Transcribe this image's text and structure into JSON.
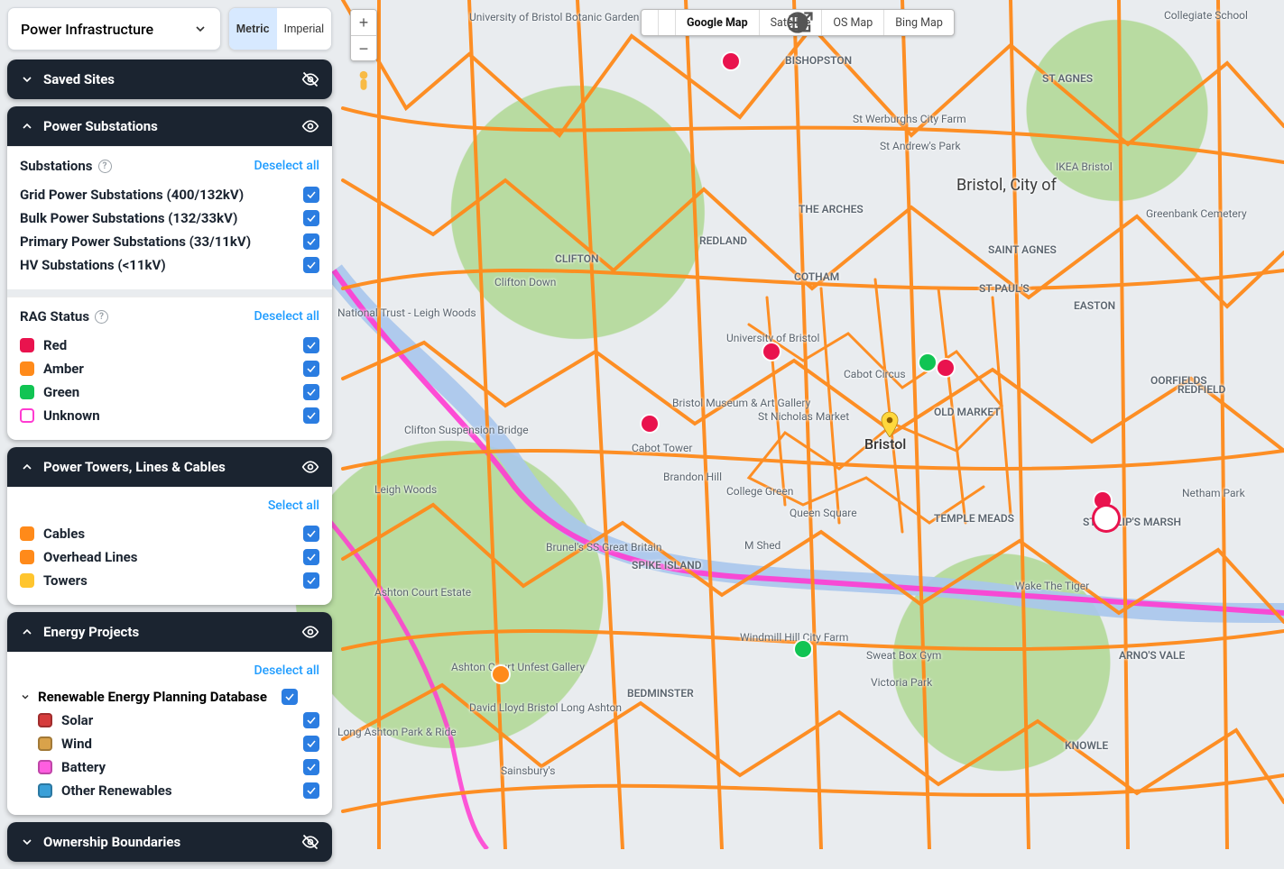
{
  "units": {
    "metric": "Metric",
    "imperial": "Imperial",
    "active": "metric"
  },
  "category": {
    "value": "Power Infrastructure"
  },
  "map_types": {
    "google": "Google Map",
    "satellite": "Satellite",
    "os": "OS Map",
    "bing": "Bing Map",
    "active": "google"
  },
  "sections": {
    "saved_sites": {
      "title": "Saved Sites",
      "expanded": false,
      "visible": false
    },
    "power_substations": {
      "title": "Power Substations",
      "expanded": true,
      "visible": true,
      "group_title": "Substations",
      "action": "Deselect all",
      "items": [
        {
          "label": "Grid Power Substations (400/132kV)",
          "checked": true
        },
        {
          "label": "Bulk Power Substations (132/33kV)",
          "checked": true
        },
        {
          "label": "Primary Power Substations (33/11kV)",
          "checked": true
        },
        {
          "label": "HV Substations (<11kV)",
          "checked": true
        }
      ],
      "rag_title": "RAG Status",
      "rag_action": "Deselect all",
      "rag": [
        {
          "label": "Red",
          "color": "#e9134e",
          "outline": false,
          "checked": true
        },
        {
          "label": "Amber",
          "color": "#ff8a1a",
          "outline": false,
          "checked": true
        },
        {
          "label": "Green",
          "color": "#11c453",
          "outline": false,
          "checked": true
        },
        {
          "label": "Unknown",
          "color": "#ff3bd1",
          "outline": true,
          "checked": true
        }
      ]
    },
    "power_lines": {
      "title": "Power Towers, Lines & Cables",
      "expanded": true,
      "visible": true,
      "action": "Select all",
      "items": [
        {
          "label": "Cables",
          "color": "#ff8a1a",
          "checked": true
        },
        {
          "label": "Overhead Lines",
          "color": "#ff8a1a",
          "checked": true
        },
        {
          "label": "Towers",
          "color": "#ffc52e",
          "checked": true
        }
      ]
    },
    "energy_projects": {
      "title": "Energy Projects",
      "expanded": true,
      "visible": true,
      "action": "Deselect all",
      "sub_title": "Renewable Energy Planning Database",
      "sub_checked": true,
      "items": [
        {
          "label": "Solar",
          "color": "#d63c3c",
          "checked": true
        },
        {
          "label": "Wind",
          "color": "#d9a24a",
          "checked": true
        },
        {
          "label": "Battery",
          "color": "#ff5ee0",
          "checked": true
        },
        {
          "label": "Other Renewables",
          "color": "#3aa0d8",
          "checked": true
        }
      ]
    },
    "ownership": {
      "title": "Ownership Boundaries",
      "expanded": false,
      "visible": false
    }
  },
  "map_labels": {
    "city": "Bristol, City of",
    "l1": "University of Bristol Botanic Garden",
    "l2": "BISHOPSTON",
    "l3": "St Werburghs City Farm",
    "l4": "St Andrew's Park",
    "l5": "Collegiate School",
    "l6": "ST AGNES",
    "l7": "IKEA Bristol",
    "l8": "Greenbank Cemetery",
    "l9": "CLIFTON",
    "l10": "Clifton Down",
    "l11": "REDLAND",
    "l12": "COTHAM",
    "l13": "ST PAUL'S",
    "l14": "EASTON",
    "l15": "SAINT AGNES",
    "l16": "National Trust - Leigh Woods",
    "l17": "Clifton Suspension Bridge",
    "l18": "University of Bristol",
    "l19": "Cabot Circus",
    "l20": "St Nicholas Market",
    "l21": "OLD MARKET",
    "l22": "REDFIELD",
    "l23": "Bristol Museum & Art Gallery",
    "l24": "Cabot Tower",
    "l25": "Brandon Hill",
    "l26": "College Green",
    "l27": "Queen Square",
    "l28": "TEMPLE MEADS",
    "l29": "Brunel's SS Great Britain",
    "l30": "SPIKE ISLAND",
    "l31": "M Shed",
    "l32": "Wake The Tiger",
    "l33": "Netham Park",
    "l34": "ARNO'S VALE",
    "l35": "Leigh Woods",
    "l36": "Ashton Court Estate",
    "l37": "Windmill Hill City Farm",
    "l38": "Sweat Box Gym",
    "l39": "Victoria Park",
    "l40": "Ashton Court Unfest Gallery",
    "l41": "David Lloyd Bristol Long Ashton",
    "l42": "Long Ashton Park & Ride",
    "l43": "Long Ashton",
    "l44": "KNOWLE",
    "l45": "Sainsbury's",
    "l46": "ST PHILIP'S MARSH",
    "l47": "OORFIELDS",
    "l48": "THE ARCHES",
    "l49": "Bristol",
    "l50": "BEDMINSTER"
  },
  "colors": {
    "cable": "#ff8a1a",
    "river": "#a9c7ec",
    "magenta": "#ff3bd1",
    "park": "#b8dba1"
  }
}
